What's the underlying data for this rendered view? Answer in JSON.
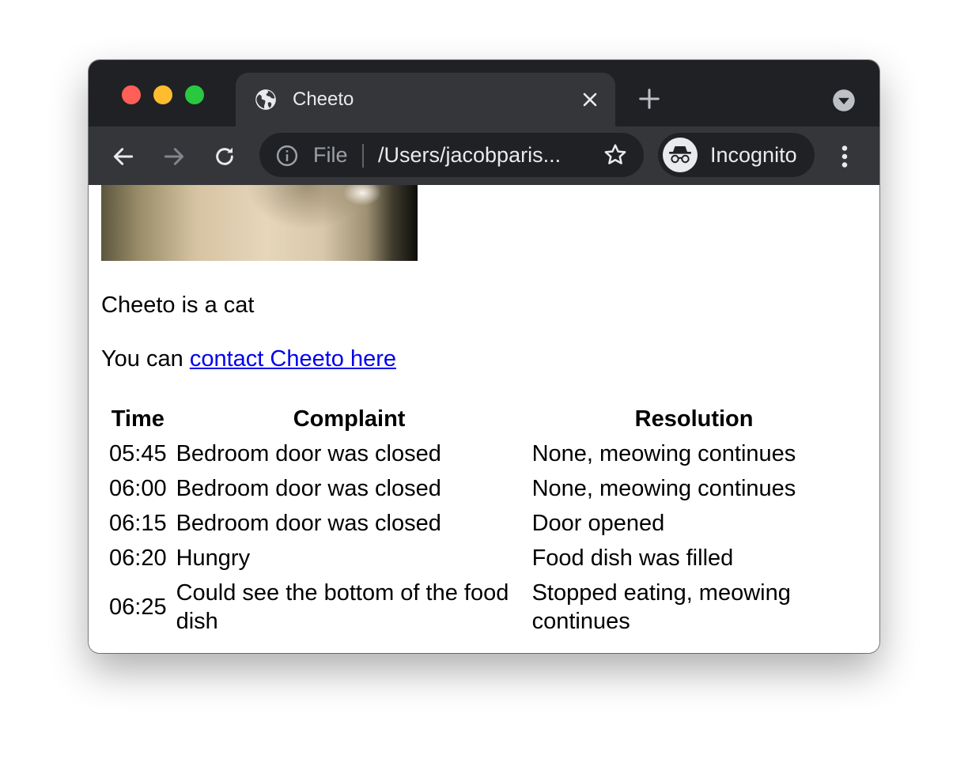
{
  "browser": {
    "tab_title": "Cheeto",
    "omnibox": {
      "scheme": "File",
      "url": "/Users/jacobparis..."
    },
    "profile_label": "Incognito"
  },
  "page": {
    "description": "Cheeto is a cat",
    "contact_prefix": "You can",
    "contact_link": "contact Cheeto here",
    "table": {
      "headers": [
        "Time",
        "Complaint",
        "Resolution"
      ],
      "rows": [
        [
          "05:45",
          "Bedroom door was closed",
          "None, meowing continues"
        ],
        [
          "06:00",
          "Bedroom door was closed",
          "None, meowing continues"
        ],
        [
          "06:15",
          "Bedroom door was closed",
          "Door opened"
        ],
        [
          "06:20",
          "Hungry",
          "Food dish was filled"
        ],
        [
          "06:25",
          "Could see the bottom of the food dish",
          "Stopped eating, meowing continues"
        ]
      ]
    }
  },
  "icons": [
    "globe-icon",
    "close-icon",
    "plus-icon",
    "chevron-down-icon",
    "back-arrow-icon",
    "forward-arrow-icon",
    "reload-icon",
    "info-icon",
    "star-icon",
    "incognito-icon",
    "more-vert-icon"
  ],
  "colors": {
    "titlebar": "#202124",
    "active_tab": "#35363a",
    "link": "#0000ee"
  }
}
